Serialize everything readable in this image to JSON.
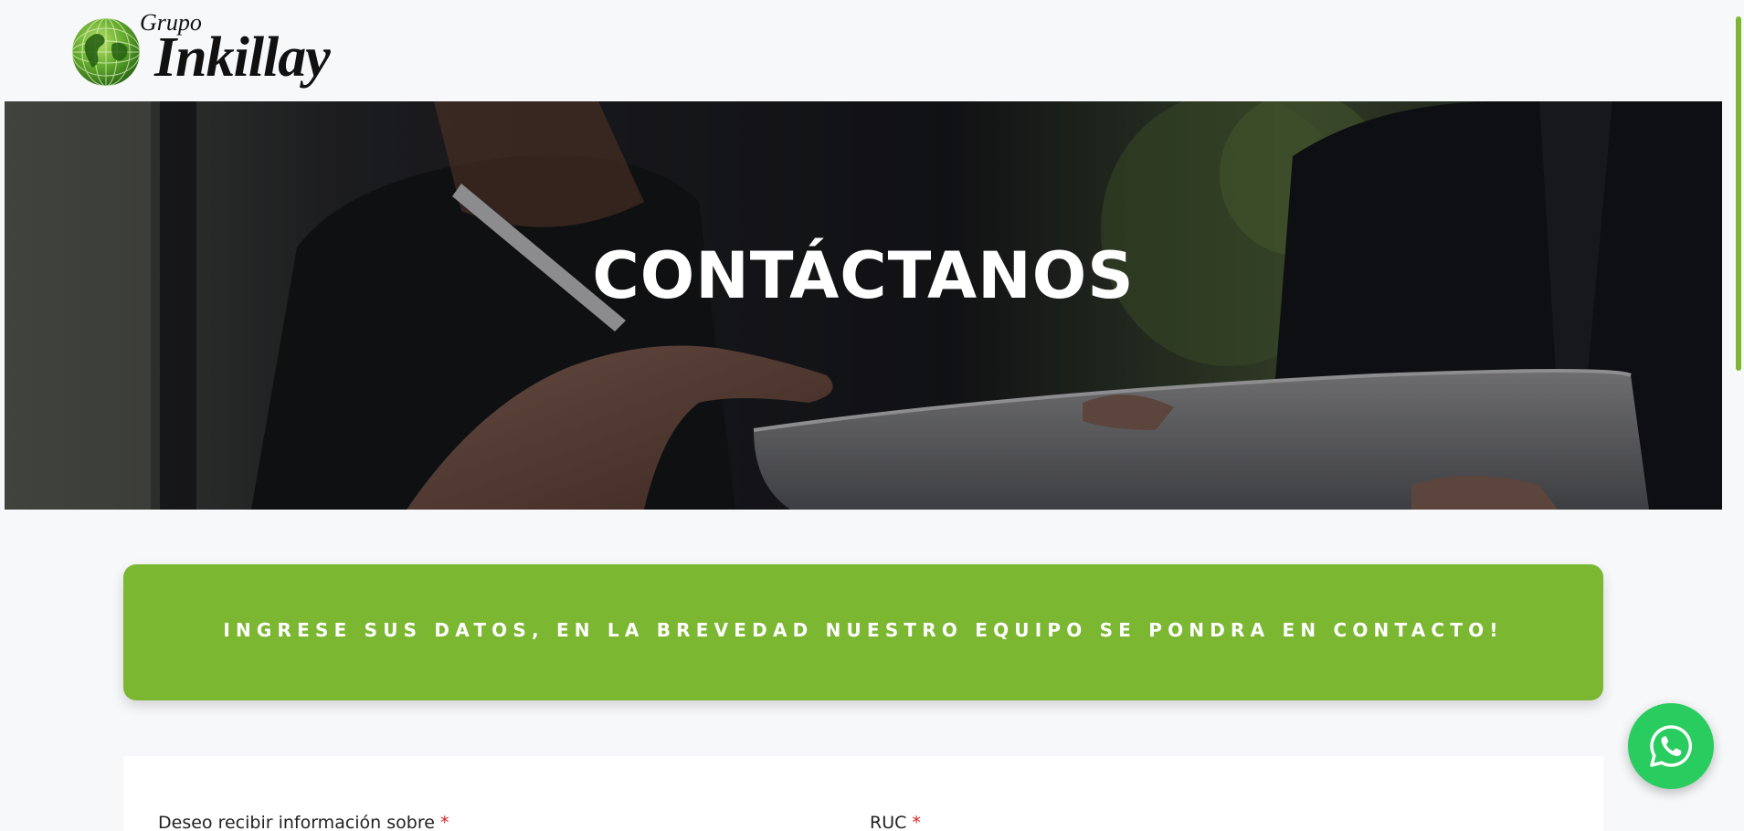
{
  "header": {
    "logo_small": "Grupo",
    "logo_big": "Inkillay",
    "logo_icon": "globe-icon"
  },
  "hero": {
    "title": "CONTÁCTANOS"
  },
  "banner": {
    "text": "INGRESE SUS DATOS, EN LA BREVEDAD NUESTRO EQUIPO SE PONDRA EN CONTACTO!",
    "color": "#7bb731"
  },
  "form": {
    "field1_label": "Deseo recibir información sobre",
    "field2_label": "RUC",
    "required_mark": "*"
  },
  "whatsapp": {
    "icon": "whatsapp-icon",
    "color": "#29cc5f"
  },
  "colors": {
    "accent": "#7bb731",
    "background": "#f7f8fa",
    "required": "#d62424"
  }
}
